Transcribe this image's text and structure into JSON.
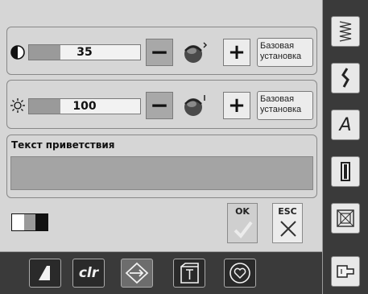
{
  "contrast": {
    "value": "35",
    "level": 0.35,
    "reset_label_line1": "Базовая",
    "reset_label_line2": "установка"
  },
  "brightness": {
    "value": "100",
    "level": 0.35,
    "reset_label_line1": "Базовая",
    "reset_label_line2": "установка"
  },
  "welcome": {
    "label": "Текст приветствия",
    "value": ""
  },
  "footer": {
    "ok_label": "OK",
    "esc_label": "ESC"
  },
  "bottom_nav": {
    "clr_label": "clr"
  },
  "side_nav": {
    "italic_label": "A"
  },
  "icons": [
    "contrast-icon",
    "sun-icon",
    "rotate-icon",
    "display-mode-icon",
    "stitch-zigzag-icon",
    "stitch-wave-icon",
    "alphabet-icon",
    "buttonhole-icon",
    "quilt-icon",
    "sewing-foot-icon",
    "clear-icon",
    "embroidery-icon",
    "setup-icon",
    "heart-icon",
    "check-icon",
    "close-icon"
  ]
}
